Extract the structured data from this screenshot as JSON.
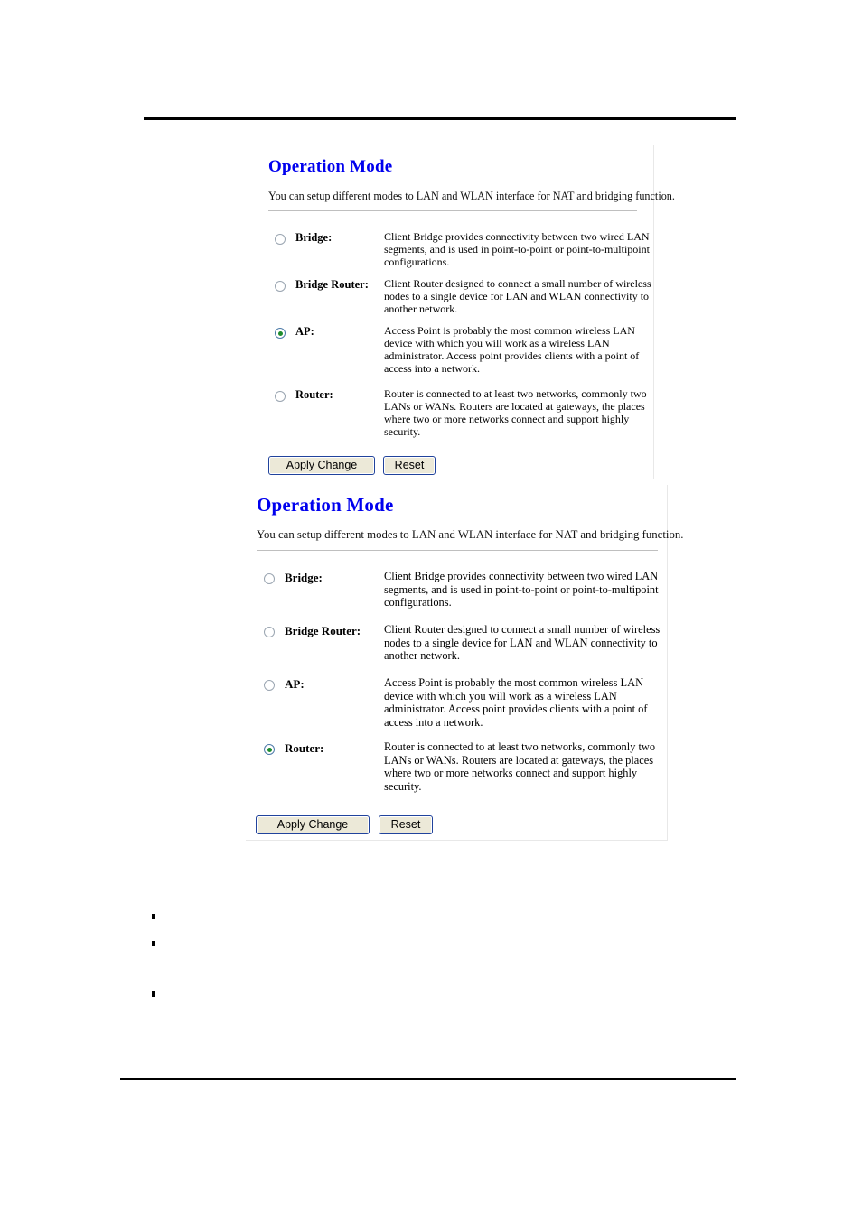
{
  "document": {
    "header_rule": "",
    "footer_rule": ""
  },
  "panels": [
    {
      "id": "panel-ap",
      "title": "Operation Mode",
      "description": "You can setup different modes to LAN and WLAN interface for NAT and bridging function.",
      "selected_mode": "AP",
      "options": [
        {
          "label": "Bridge:",
          "checked": false,
          "description": "Client Bridge provides connectivity between two wired LAN segments, and is used in point-to-point or point-to-multipoint configurations."
        },
        {
          "label": "Bridge Router:",
          "checked": false,
          "description": "Client Router designed to connect a small number of wireless nodes to a single device for LAN and WLAN connectivity to another network."
        },
        {
          "label": "AP:",
          "checked": true,
          "description": "Access Point is probably the most common wireless LAN device with which you will work as a wireless LAN administrator. Access point provides clients with a point of access into a network."
        },
        {
          "label": "Router:",
          "checked": false,
          "description": "Router is connected to at least two networks, commonly two LANs or WANs. Routers are located at gateways, the places where two or more networks connect and support highly security."
        }
      ],
      "buttons": {
        "apply": "Apply Change",
        "reset": "Reset"
      }
    },
    {
      "id": "panel-router",
      "title": "Operation Mode",
      "description": "You can setup different modes to LAN and WLAN interface for NAT and bridging function.",
      "selected_mode": "Router",
      "options": [
        {
          "label": "Bridge:",
          "checked": false,
          "description": "Client Bridge provides connectivity between two wired LAN segments, and is used in point-to-point or point-to-multipoint configurations."
        },
        {
          "label": "Bridge Router:",
          "checked": false,
          "description": "Client Router designed to connect a small number of wireless nodes to a single device for LAN and WLAN connectivity to another network."
        },
        {
          "label": "AP:",
          "checked": false,
          "description": "Access Point is probably the most common wireless LAN device with which you will work as a wireless LAN administrator. Access point provides clients with a point of access into a network."
        },
        {
          "label": "Router:",
          "checked": true,
          "description": "Router is connected to at least two networks, commonly two LANs or WANs. Routers are located at gateways, the places where two or more networks connect and support highly security."
        }
      ],
      "buttons": {
        "apply": "Apply Change",
        "reset": "Reset"
      }
    }
  ],
  "bullets": [
    {
      "text": ""
    },
    {
      "text": ""
    },
    {
      "text": ""
    }
  ],
  "colors": {
    "title_blue": "#0000ee",
    "radio_dot_green": "#1e8c2e",
    "button_face": "#ece9d8",
    "button_border": "#21439c",
    "rule_black": "#000000"
  }
}
